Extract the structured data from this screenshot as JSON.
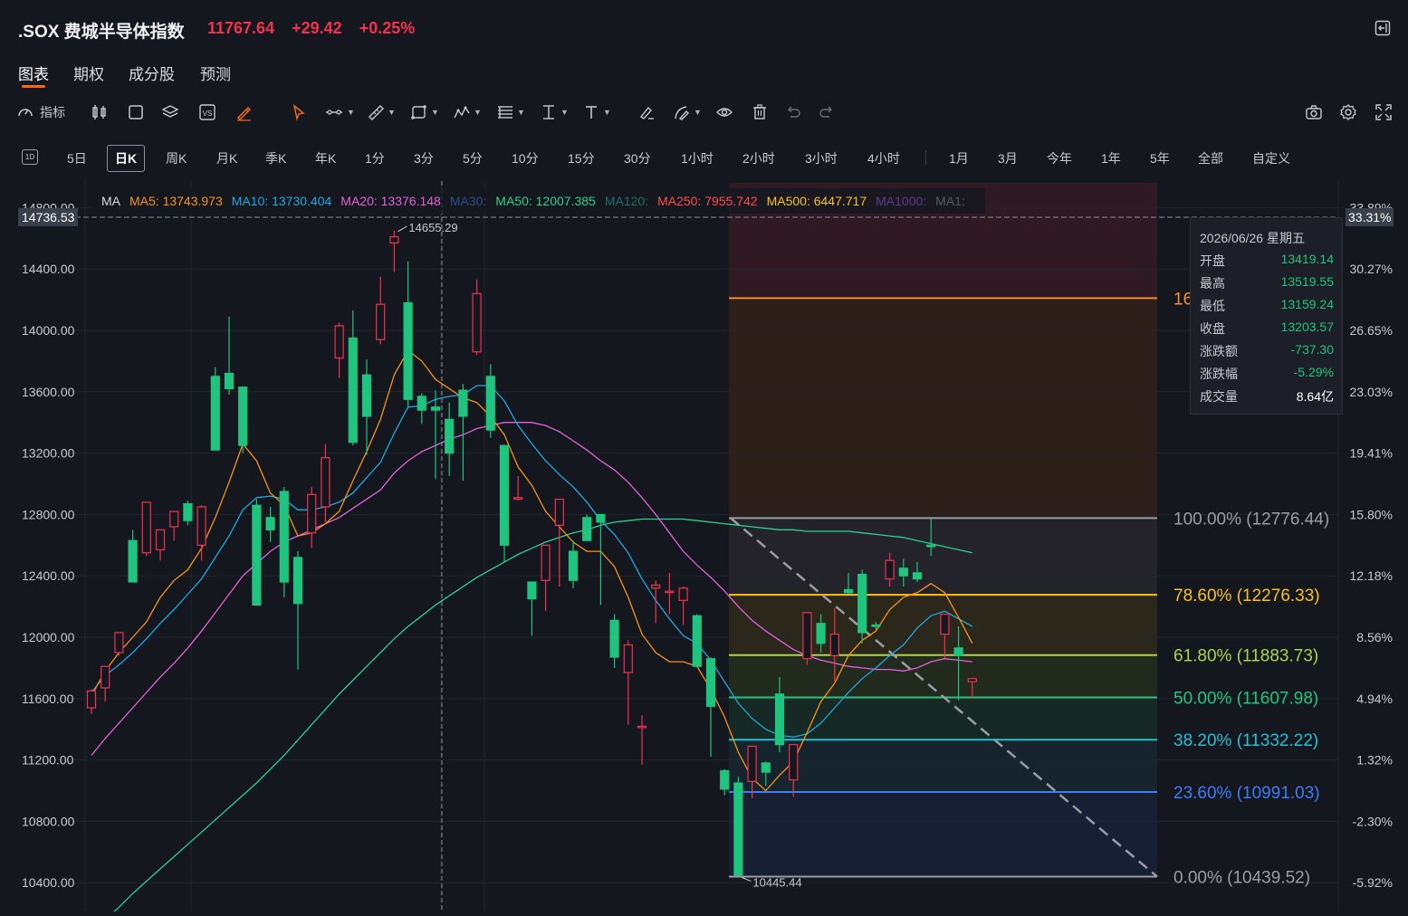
{
  "header": {
    "symbol_name": ".SOX 费城半导体指数",
    "price": "11767.64",
    "change": "+29.42",
    "change_pct": "+0.25%",
    "exit_icon": "exit-fullscreen-icon"
  },
  "tabs": [
    {
      "label": "图表",
      "active": true
    },
    {
      "label": "期权",
      "active": false
    },
    {
      "label": "成分股",
      "active": false
    },
    {
      "label": "预测",
      "active": false
    }
  ],
  "toolbar": {
    "indicator_label": "指标",
    "icons": [
      "indicator-gauge-icon",
      "candle-style-icon",
      "rectangle-icon",
      "layers-icon",
      "vs-compare-icon",
      "brush-icon",
      "cursor-icon",
      "line-tool-icon",
      "ruler-tool-icon",
      "shape-tool-icon",
      "pattern-tool-icon",
      "fibonacci-tool-icon",
      "vertical-tool-icon",
      "text-tool-icon",
      "annotation-icon",
      "draw-pen-icon",
      "eye-icon",
      "trash-icon",
      "undo-icon",
      "redo-icon",
      "camera-icon",
      "gear-icon",
      "fullscreen-icon"
    ]
  },
  "periods": {
    "first": "1D",
    "items": [
      "5日",
      "日K",
      "周K",
      "月K",
      "季K",
      "年K",
      "1分",
      "3分",
      "5分",
      "10分",
      "15分",
      "30分",
      "1小时",
      "2小时",
      "3小时",
      "4小时"
    ],
    "active": "日K",
    "ranges": [
      "1月",
      "3月",
      "今年",
      "1年",
      "5年",
      "全部",
      "自定义"
    ]
  },
  "ma_legend": {
    "label": "MA",
    "items": [
      {
        "text": "MA5: 13743.973",
        "color": "#f7931a"
      },
      {
        "text": "MA10: 13730.404",
        "color": "#1fa8e0"
      },
      {
        "text": "MA20: 13376.148",
        "color": "#e163d8"
      },
      {
        "text": "MA30:",
        "color": "#2b4f86"
      },
      {
        "text": "MA50: 12007.385",
        "color": "#2bd192"
      },
      {
        "text": "MA120:",
        "color": "#1f6f6a"
      },
      {
        "text": "MA250: 7955.742",
        "color": "#ff4d4d"
      },
      {
        "text": "MA500: 6447.717",
        "color": "#f6c21c"
      },
      {
        "text": "MA1000:",
        "color": "#5a3c8a"
      },
      {
        "text": "MA1:",
        "color": "#555a66"
      }
    ]
  },
  "crosshair": {
    "left_price": "14736.53",
    "right_pct": "33.31%"
  },
  "info_panel": {
    "date": "2026/06/26 星期五",
    "rows": [
      {
        "k": "开盘",
        "v": "13419.14",
        "color": "#1fc47e"
      },
      {
        "k": "最高",
        "v": "13519.55",
        "color": "#1fc47e"
      },
      {
        "k": "最低",
        "v": "13159.24",
        "color": "#1fc47e"
      },
      {
        "k": "收盘",
        "v": "13203.57",
        "color": "#1fc47e"
      },
      {
        "k": "涨跌额",
        "v": "-737.30",
        "color": "#1fc47e"
      },
      {
        "k": "涨跌幅",
        "v": "-5.29%",
        "color": "#1fc47e"
      },
      {
        "k": "成交量",
        "v": "8.64亿",
        "color": "#ffffff"
      }
    ]
  },
  "chart_data": {
    "type": "candlestick",
    "y_axis_left": [
      "14800.00",
      "14400.00",
      "14000.00",
      "13600.00",
      "13200.00",
      "12800.00",
      "12400.00",
      "12000.00",
      "11600.00",
      "11200.00",
      "10800.00",
      "10400.00"
    ],
    "y_axis_right": [
      "33.89%",
      "30.27%",
      "26.65%",
      "23.03%",
      "19.41%",
      "15.80%",
      "12.18%",
      "8.56%",
      "4.94%",
      "1.32%",
      "-2.30%",
      "-5.92%"
    ],
    "ylim": [
      10330,
      14960
    ],
    "annotations": {
      "high": "14655.29",
      "low": "10445.44"
    },
    "candles": [
      {
        "o": 11540,
        "h": 11660,
        "l": 11500,
        "c": 11650
      },
      {
        "o": 11670,
        "h": 11720,
        "l": 11580,
        "c": 11810
      },
      {
        "o": 11900,
        "h": 12000,
        "l": 11880,
        "c": 12030
      },
      {
        "o": 12630,
        "h": 12700,
        "l": 12450,
        "c": 12360
      },
      {
        "o": 12550,
        "h": 12820,
        "l": 12530,
        "c": 12880
      },
      {
        "o": 12570,
        "h": 12660,
        "l": 12500,
        "c": 12700
      },
      {
        "o": 12720,
        "h": 12780,
        "l": 12630,
        "c": 12820
      },
      {
        "o": 12870,
        "h": 12890,
        "l": 12730,
        "c": 12760
      },
      {
        "o": 12600,
        "h": 12860,
        "l": 12500,
        "c": 12850
      },
      {
        "o": 13700,
        "h": 13760,
        "l": 13330,
        "c": 13220
      },
      {
        "o": 13720,
        "h": 14090,
        "l": 13580,
        "c": 13620
      },
      {
        "o": 13630,
        "h": 13600,
        "l": 13200,
        "c": 13250
      },
      {
        "o": 12860,
        "h": 12900,
        "l": 12210,
        "c": 12210
      },
      {
        "o": 12780,
        "h": 12850,
        "l": 12620,
        "c": 12700
      },
      {
        "o": 12950,
        "h": 12980,
        "l": 12260,
        "c": 12360
      },
      {
        "o": 12520,
        "h": 12560,
        "l": 11790,
        "c": 12220
      },
      {
        "o": 12680,
        "h": 12980,
        "l": 12580,
        "c": 12930
      },
      {
        "o": 12850,
        "h": 13260,
        "l": 12750,
        "c": 13170
      },
      {
        "o": 13820,
        "h": 14050,
        "l": 13690,
        "c": 14030
      },
      {
        "o": 13950,
        "h": 14130,
        "l": 13250,
        "c": 13270
      },
      {
        "o": 13710,
        "h": 13810,
        "l": 13190,
        "c": 13440
      },
      {
        "o": 13940,
        "h": 14350,
        "l": 13910,
        "c": 14170
      },
      {
        "o": 14570,
        "h": 14650,
        "l": 14380,
        "c": 14610
      },
      {
        "o": 14180,
        "h": 14450,
        "l": 13500,
        "c": 13550
      },
      {
        "o": 13570,
        "h": 13590,
        "l": 13390,
        "c": 13480
      },
      {
        "o": 13500,
        "h": 13610,
        "l": 13030,
        "c": 13480
      },
      {
        "o": 13420,
        "h": 13530,
        "l": 13050,
        "c": 13200
      },
      {
        "o": 13610,
        "h": 13650,
        "l": 13020,
        "c": 13440
      },
      {
        "o": 13860,
        "h": 14330,
        "l": 13840,
        "c": 14240
      },
      {
        "o": 13700,
        "h": 13780,
        "l": 13300,
        "c": 13350
      },
      {
        "o": 13250,
        "h": 13240,
        "l": 12490,
        "c": 12600
      },
      {
        "o": 12900,
        "h": 13050,
        "l": 12890,
        "c": 12910
      },
      {
        "o": 12360,
        "h": 12360,
        "l": 12010,
        "c": 12250
      },
      {
        "o": 12370,
        "h": 12450,
        "l": 12170,
        "c": 12600
      },
      {
        "o": 12730,
        "h": 12790,
        "l": 12330,
        "c": 12900
      },
      {
        "o": 12560,
        "h": 12630,
        "l": 12320,
        "c": 12370
      },
      {
        "o": 12780,
        "h": 12800,
        "l": 12660,
        "c": 12630
      },
      {
        "o": 12800,
        "h": 12760,
        "l": 12210,
        "c": 12750
      },
      {
        "o": 12110,
        "h": 12150,
        "l": 11800,
        "c": 11870
      },
      {
        "o": 11770,
        "h": 11980,
        "l": 11430,
        "c": 11950
      },
      {
        "o": 11420,
        "h": 11490,
        "l": 11170,
        "c": 11420
      },
      {
        "o": 12320,
        "h": 12370,
        "l": 12090,
        "c": 12340
      },
      {
        "o": 12300,
        "h": 12420,
        "l": 12150,
        "c": 12300
      },
      {
        "o": 12240,
        "h": 12330,
        "l": 12080,
        "c": 12320
      },
      {
        "o": 12140,
        "h": 12150,
        "l": 11810,
        "c": 11810
      },
      {
        "o": 11860,
        "h": 11870,
        "l": 11220,
        "c": 11550
      },
      {
        "o": 11130,
        "h": 11140,
        "l": 10970,
        "c": 11010
      },
      {
        "o": 11050,
        "h": 11090,
        "l": 10445,
        "c": 10450
      },
      {
        "o": 11060,
        "h": 11240,
        "l": 10950,
        "c": 11290
      },
      {
        "o": 11180,
        "h": 11190,
        "l": 11030,
        "c": 11120
      },
      {
        "o": 11630,
        "h": 11740,
        "l": 11250,
        "c": 11300
      },
      {
        "o": 11070,
        "h": 11260,
        "l": 10960,
        "c": 11300
      },
      {
        "o": 11860,
        "h": 12140,
        "l": 11820,
        "c": 12160
      },
      {
        "o": 12090,
        "h": 12150,
        "l": 11900,
        "c": 11960
      },
      {
        "o": 11880,
        "h": 12190,
        "l": 11700,
        "c": 12020
      },
      {
        "o": 12310,
        "h": 12420,
        "l": 12280,
        "c": 12290
      },
      {
        "o": 12410,
        "h": 12440,
        "l": 11960,
        "c": 12030
      },
      {
        "o": 12080,
        "h": 12100,
        "l": 12050,
        "c": 12070
      },
      {
        "o": 12380,
        "h": 12550,
        "l": 12330,
        "c": 12500
      },
      {
        "o": 12450,
        "h": 12510,
        "l": 12330,
        "c": 12400
      },
      {
        "o": 12420,
        "h": 12490,
        "l": 12360,
        "c": 12380
      },
      {
        "o": 12600,
        "h": 12770,
        "l": 12530,
        "c": 12590
      },
      {
        "o": 12020,
        "h": 12050,
        "l": 11860,
        "c": 12150
      },
      {
        "o": 11930,
        "h": 12070,
        "l": 11590,
        "c": 11880
      },
      {
        "o": 11710,
        "h": 11710,
        "l": 11600,
        "c": 11730
      }
    ],
    "ma5": [
      11620,
      11780,
      11900,
      12000,
      12100,
      12260,
      12370,
      12440,
      12580,
      12780,
      13010,
      13260,
      13150,
      12940,
      12860,
      12660,
      12680,
      12740,
      12820,
      13020,
      13210,
      13420,
      13710,
      13870,
      13800,
      13680,
      13620,
      13560,
      13530,
      13440,
      13320,
      13110,
      12990,
      12820,
      12720,
      12620,
      12560,
      12560,
      12460,
      12260,
      12020,
      11900,
      11840,
      11840,
      11810,
      11660,
      11480,
      11250,
      11080,
      11000,
      11100,
      11190,
      11380,
      11580,
      11700,
      11880,
      11980,
      12040,
      12180,
      12260,
      12290,
      12350,
      12290,
      12130,
      11960
    ],
    "ma10": [
      11640,
      11750,
      11820,
      11900,
      11990,
      12090,
      12180,
      12280,
      12380,
      12520,
      12660,
      12830,
      12910,
      12920,
      12900,
      12830,
      12830,
      12850,
      12880,
      12940,
      13040,
      13140,
      13330,
      13500,
      13510,
      13550,
      13570,
      13580,
      13640,
      13640,
      13540,
      13380,
      13260,
      13150,
      13060,
      12980,
      12880,
      12760,
      12670,
      12550,
      12380,
      12240,
      12120,
      12010,
      11960,
      11850,
      11710,
      11570,
      11470,
      11400,
      11360,
      11350,
      11370,
      11440,
      11540,
      11640,
      11730,
      11800,
      11880,
      11950,
      12060,
      12140,
      12170,
      12120,
      12070
    ],
    "ma20": [
      11230,
      11340,
      11440,
      11540,
      11640,
      11740,
      11830,
      11930,
      12040,
      12160,
      12280,
      12400,
      12480,
      12560,
      12620,
      12660,
      12700,
      12740,
      12780,
      12840,
      12900,
      12960,
      13070,
      13150,
      13210,
      13250,
      13290,
      13320,
      13360,
      13380,
      13400,
      13400,
      13400,
      13380,
      13340,
      13280,
      13220,
      13150,
      13090,
      13010,
      12910,
      12800,
      12680,
      12560,
      12470,
      12390,
      12300,
      12200,
      12110,
      12040,
      11980,
      11920,
      11880,
      11850,
      11830,
      11810,
      11800,
      11790,
      11790,
      11780,
      11800,
      11840,
      11860,
      11850,
      11840
    ],
    "ma50": [
      10080,
      10160,
      10240,
      10330,
      10410,
      10490,
      10570,
      10650,
      10730,
      10810,
      10890,
      10970,
      11050,
      11140,
      11230,
      11330,
      11430,
      11530,
      11630,
      11720,
      11810,
      11900,
      11990,
      12070,
      12140,
      12210,
      12270,
      12330,
      12390,
      12440,
      12490,
      12540,
      12580,
      12620,
      12650,
      12680,
      12700,
      12730,
      12750,
      12760,
      12770,
      12770,
      12770,
      12770,
      12760,
      12750,
      12740,
      12730,
      12720,
      12710,
      12700,
      12700,
      12690,
      12690,
      12690,
      12690,
      12680,
      12670,
      12660,
      12650,
      12630,
      12610,
      12590,
      12570,
      12550
    ],
    "fib": [
      {
        "label": "161.8%",
        "value": 14210,
        "color": "#ff8a1e"
      },
      {
        "label": "100.00% (12776.44)",
        "value": 12776.44,
        "color": "#9a9da4"
      },
      {
        "label": "78.60% (12276.33)",
        "value": 12276.33,
        "color": "#f6c21c"
      },
      {
        "label": "61.80% (11883.73)",
        "value": 11883.73,
        "color": "#a9d44a"
      },
      {
        "label": "50.00% (11607.98)",
        "value": 11607.98,
        "color": "#21c782"
      },
      {
        "label": "38.20% (11332.22)",
        "value": 11332.22,
        "color": "#21c1d6"
      },
      {
        "label": "23.60% (10991.03)",
        "value": 10991.03,
        "color": "#3f7cf4"
      },
      {
        "label": "0.00% (10439.52)",
        "value": 10439.52,
        "color": "#9a9da4"
      }
    ]
  }
}
